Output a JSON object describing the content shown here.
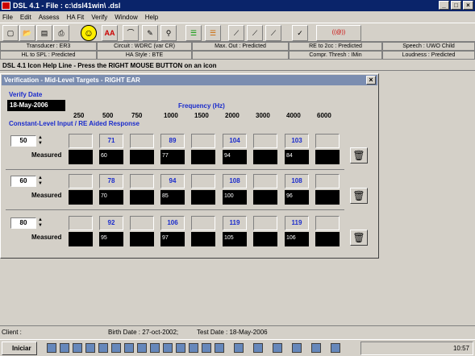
{
  "window": {
    "title": "DSL 4.1 - File : c:\\dsl41win\\        .dsl",
    "min": "_",
    "max": "□",
    "close": "×"
  },
  "menu": [
    "File",
    "Edit",
    "Assess",
    "HA Fit",
    "Verify",
    "Window",
    "Help"
  ],
  "status": {
    "transducer": "Transducer : ER3",
    "circuit": "Circuit : WDRC (var CR)",
    "max_out": "Max. Out : Predicted",
    "re_to_2cc": "RE to 2cc : Predicted",
    "speech": "Speech : UWO Child",
    "hl_to_spl": "HL to SPL : Predicted",
    "ha_style": "HA Style : BTE",
    "compr": "Compr. Thresh : IMin",
    "loudness": "Loudness : Predicted"
  },
  "helpline": "DSL 4.1 Icon Help Line - Press the RIGHT MOUSE BUTTON on an icon",
  "dialog": {
    "title": "Verification - Mid-Level Targets - RIGHT EAR",
    "verify_date_label": "Verify Date",
    "verify_date": "18-May-2006",
    "freq_label": "Frequency (Hz)",
    "section_label": "Constant-Level Input / RE Aided Response",
    "frequencies": [
      "250",
      "500",
      "750",
      "1000",
      "1500",
      "2000",
      "3000",
      "4000",
      "6000"
    ],
    "measured_label": "Measured",
    "rows": [
      {
        "level": "50",
        "targets": [
          "",
          "71",
          "",
          "89",
          "",
          "104",
          "",
          "103",
          ""
        ],
        "measured": [
          "",
          "60",
          "",
          "77",
          "",
          "94",
          "",
          "84",
          ""
        ]
      },
      {
        "level": "60",
        "targets": [
          "",
          "78",
          "",
          "94",
          "",
          "108",
          "",
          "108",
          ""
        ],
        "measured": [
          "",
          "70",
          "",
          "85",
          "",
          "100",
          "",
          "96",
          ""
        ]
      },
      {
        "level": "80",
        "targets": [
          "",
          "92",
          "",
          "106",
          "",
          "119",
          "",
          "119",
          ""
        ],
        "measured": [
          "",
          "95",
          "",
          "97",
          "",
          "105",
          "",
          "106",
          ""
        ]
      }
    ]
  },
  "client": {
    "label": "Client :",
    "birth": "Birth Date : 27-oct-2002;",
    "test": "Test Date : 18-May-2006"
  },
  "taskbar": {
    "start": "Iniciar",
    "clock": "10:57"
  }
}
